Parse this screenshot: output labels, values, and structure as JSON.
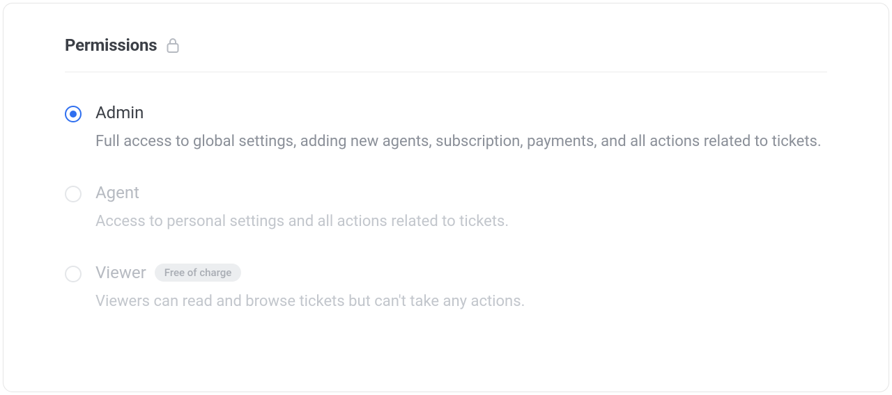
{
  "section": {
    "title": "Permissions"
  },
  "options": [
    {
      "label": "Admin",
      "description": "Full access to global settings, adding new agents, subscription, payments, and all actions related to tickets.",
      "selected": true,
      "disabled": false,
      "badge": null
    },
    {
      "label": "Agent",
      "description": "Access to personal settings and all actions related to tickets.",
      "selected": false,
      "disabled": true,
      "badge": null
    },
    {
      "label": "Viewer",
      "description": "Viewers can read and browse tickets but can't take any actions.",
      "selected": false,
      "disabled": true,
      "badge": "Free of charge"
    }
  ]
}
